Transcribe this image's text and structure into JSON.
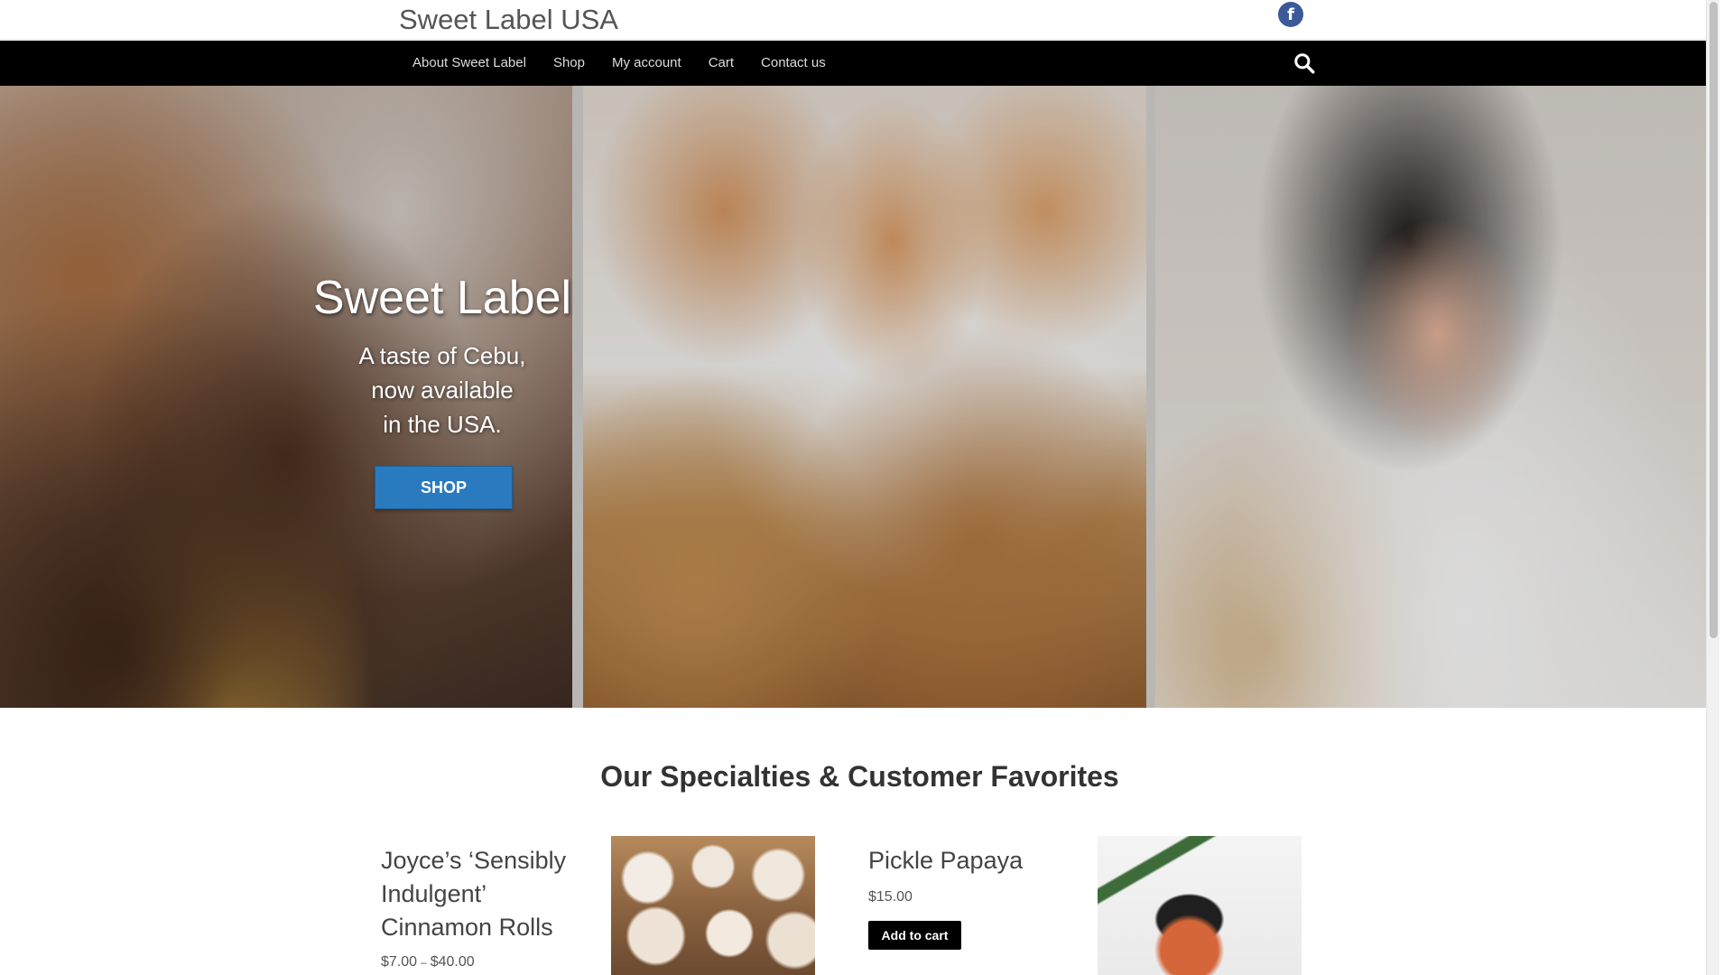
{
  "site": {
    "title": "Sweet Label USA"
  },
  "social": {
    "facebook_icon": "facebook-icon"
  },
  "nav": {
    "items": [
      {
        "label": "About Sweet Label"
      },
      {
        "label": "Shop"
      },
      {
        "label": "My account"
      },
      {
        "label": "Cart"
      },
      {
        "label": "Contact us"
      }
    ],
    "search_icon": "search-icon"
  },
  "hero": {
    "title": "Sweet Label",
    "tagline": [
      "A taste of Cebu,",
      "now available",
      "in the USA."
    ],
    "button_label": "SHOP",
    "button_color": "#2a7ac0"
  },
  "specialties": {
    "heading": "Our Specialties & Customer Favorites",
    "products": [
      {
        "name_lines": [
          "Joyce’s ‘Sensibly",
          "Indulgent’",
          "Cinnamon Rolls"
        ],
        "price_min": "$7.00",
        "price_sep": "–",
        "price_max": "$40.00"
      },
      {
        "name": "Pickle Papaya",
        "price": "$15.00",
        "cart_label": "Add to cart"
      }
    ]
  },
  "colors": {
    "navbar": "#000000",
    "facebook": "#3b5998",
    "accent": "#2a7ac0"
  }
}
